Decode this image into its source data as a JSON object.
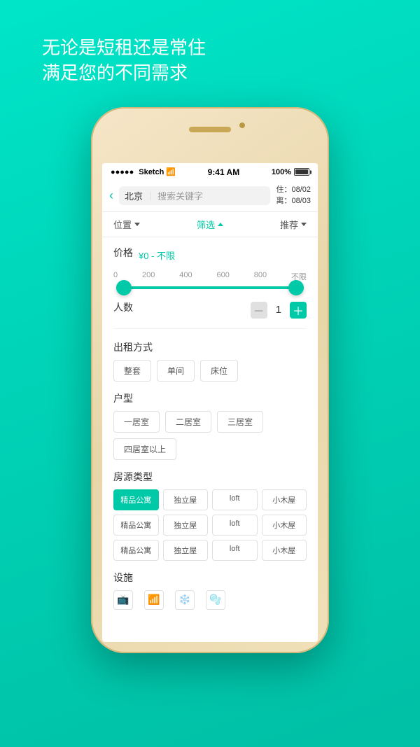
{
  "background": {
    "gradient_start": "#00e5c8",
    "gradient_end": "#00bfa5"
  },
  "header": {
    "line1": "无论是短租还是常住",
    "line2": "满足您的不同需求"
  },
  "status_bar": {
    "signal": "•••••",
    "carrier": "Sketch",
    "wifi": "wifi",
    "time": "9:41 AM",
    "battery_percent": "100%"
  },
  "search": {
    "back_label": "‹",
    "location": "北京",
    "placeholder": "搜索关键字",
    "checkin_label": "住：08/02",
    "checkout_label": "离：08/03"
  },
  "filter_bar": {
    "position_label": "位置",
    "filter_label": "筛选",
    "recommend_label": "推荐"
  },
  "price": {
    "title": "价格",
    "range_label": "¥0 - 不限",
    "min": "0",
    "labels": [
      "0",
      "200",
      "400",
      "600",
      "800",
      "不限"
    ]
  },
  "people": {
    "title": "人数",
    "count": "1",
    "minus_label": "－",
    "plus_label": "＋"
  },
  "rental_type": {
    "title": "出租方式",
    "options": [
      {
        "label": "整套",
        "active": false
      },
      {
        "label": "单间",
        "active": false
      },
      {
        "label": "床位",
        "active": false
      }
    ]
  },
  "room_layout": {
    "title": "户型",
    "options": [
      {
        "label": "一居室",
        "active": false
      },
      {
        "label": "二居室",
        "active": false
      },
      {
        "label": "三居室",
        "active": false
      },
      {
        "label": "四居室以上",
        "active": false
      }
    ]
  },
  "room_type": {
    "title": "房源类型",
    "rows": [
      [
        {
          "label": "精品公寓",
          "active": true
        },
        {
          "label": "独立屋",
          "active": false
        },
        {
          "label": "loft",
          "active": false
        },
        {
          "label": "小木屋",
          "active": false
        }
      ],
      [
        {
          "label": "精品公寓",
          "active": false
        },
        {
          "label": "独立屋",
          "active": false
        },
        {
          "label": "loft",
          "active": false
        },
        {
          "label": "小木屋",
          "active": false
        }
      ],
      [
        {
          "label": "精品公寓",
          "active": false
        },
        {
          "label": "独立屋",
          "active": false
        },
        {
          "label": "loft",
          "active": false
        },
        {
          "label": "小木屋",
          "active": false
        }
      ]
    ]
  },
  "facilities": {
    "title": "设施"
  },
  "colors": {
    "primary": "#00c9a7",
    "text_dark": "#333333",
    "text_light": "#999999",
    "border": "#e0e0e0"
  }
}
